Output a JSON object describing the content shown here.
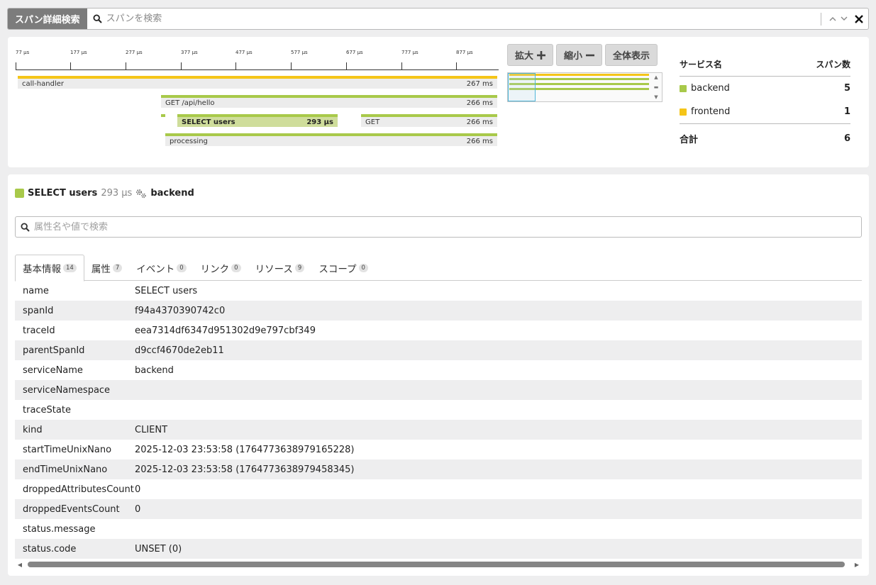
{
  "header": {
    "title": "スパン詳細検索",
    "search_placeholder": "スパンを検索"
  },
  "timeline": {
    "ticks": [
      "77 μs",
      "177 μs",
      "277 μs",
      "377 μs",
      "477 μs",
      "577 μs",
      "677 μs",
      "777 μs",
      "877 μs"
    ],
    "spans": [
      {
        "name": "call-handler",
        "duration": "267 ms",
        "service": "frontend"
      },
      {
        "name": "GET /api/hello",
        "duration": "266 ms",
        "service": "backend"
      },
      {
        "name": "SELECT users",
        "duration": "293 μs",
        "service": "backend",
        "selected": true
      },
      {
        "name": "GET",
        "duration": "266 ms",
        "service": "backend"
      },
      {
        "name": "processing",
        "duration": "266 ms",
        "service": "backend"
      }
    ]
  },
  "zoom": {
    "zoom_in": "拡大",
    "zoom_out": "縮小",
    "fit_all": "全体表示"
  },
  "services": {
    "header_name": "サービス名",
    "header_count": "スパン数",
    "rows": [
      {
        "name": "backend",
        "count": "5",
        "color": "#a8c94a"
      },
      {
        "name": "frontend",
        "count": "1",
        "color": "#f5c518"
      }
    ],
    "total_label": "合計",
    "total_count": "6"
  },
  "detail": {
    "span_name": "SELECT users",
    "duration": "293 μs",
    "service": "backend",
    "attr_search_placeholder": "属性名や値で検索",
    "tabs": [
      {
        "label": "基本情報",
        "count": "14"
      },
      {
        "label": "属性",
        "count": "7"
      },
      {
        "label": "イベント",
        "count": "0"
      },
      {
        "label": "リンク",
        "count": "0"
      },
      {
        "label": "リソース",
        "count": "9"
      },
      {
        "label": "スコープ",
        "count": "0"
      }
    ],
    "rows": [
      {
        "key": "name",
        "value": "SELECT users"
      },
      {
        "key": "spanId",
        "value": "f94a4370390742c0"
      },
      {
        "key": "traceId",
        "value": "eea7314df6347d951302d9e797cbf349"
      },
      {
        "key": "parentSpanId",
        "value": "d9ccf4670de2eb11"
      },
      {
        "key": "serviceName",
        "value": "backend"
      },
      {
        "key": "serviceNamespace",
        "value": ""
      },
      {
        "key": "traceState",
        "value": ""
      },
      {
        "key": "kind",
        "value": "CLIENT"
      },
      {
        "key": "startTimeUnixNano",
        "value": "2025-12-03 23:53:58 (1764773638979165228)"
      },
      {
        "key": "endTimeUnixNano",
        "value": "2025-12-03 23:53:58 (1764773638979458345)"
      },
      {
        "key": "droppedAttributesCount",
        "value": "0"
      },
      {
        "key": "droppedEventsCount",
        "value": "0"
      },
      {
        "key": "status.message",
        "value": ""
      },
      {
        "key": "status.code",
        "value": "UNSET (0)"
      }
    ]
  },
  "colors": {
    "backend": "#a8c94a",
    "frontend": "#f5c518",
    "selected_bg": "#cfdd9b"
  }
}
